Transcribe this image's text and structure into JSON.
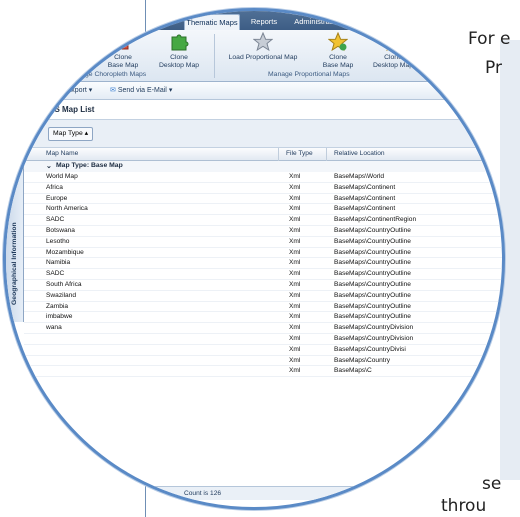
{
  "document": {
    "line1": "For e",
    "line2": "Pr",
    "line3": "se",
    "line4": "throu"
  },
  "ribbon": {
    "tabs": [
      "aps",
      "Thematic Maps",
      "Reports",
      "Administration"
    ],
    "active_tab": "Thematic Maps",
    "buttons": {
      "clone_base_map": "Clone\nBase Map",
      "clone_desktop_map": "Clone\nDesktop Map",
      "load_proportional_map": "Load Proportional Map",
      "clone_base_map_2": "Clone\nBase Map",
      "clone_desktop_map_2": "Clone\nDesktop Map"
    },
    "groups": {
      "choropleth": "Manage Choropleth Maps",
      "proportional": "Manage Proportional Maps"
    }
  },
  "toolbar": {
    "export": "Export",
    "send_email": "Send via E-Mail"
  },
  "list": {
    "title": "GIS Map List",
    "group_button": "Map Type",
    "side_tab": "Geographical Information",
    "columns": {
      "name": "Map Name",
      "type": "File Type",
      "location": "Relative Location"
    },
    "group_label": "Map Type: Base Map",
    "rows": [
      {
        "name": "World Map",
        "type": "Xml",
        "loc": "BaseMaps\\World"
      },
      {
        "name": "Africa",
        "type": "Xml",
        "loc": "BaseMaps\\Continent"
      },
      {
        "name": "Europe",
        "type": "Xml",
        "loc": "BaseMaps\\Continent"
      },
      {
        "name": "North America",
        "type": "Xml",
        "loc": "BaseMaps\\Continent"
      },
      {
        "name": "SADC",
        "type": "Xml",
        "loc": "BaseMaps\\ContinentRegion"
      },
      {
        "name": "Botswana",
        "type": "Xml",
        "loc": "BaseMaps\\CountryOutline"
      },
      {
        "name": "Lesotho",
        "type": "Xml",
        "loc": "BaseMaps\\CountryOutline"
      },
      {
        "name": "Mozambique",
        "type": "Xml",
        "loc": "BaseMaps\\CountryOutline"
      },
      {
        "name": "Namibia",
        "type": "Xml",
        "loc": "BaseMaps\\CountryOutline"
      },
      {
        "name": "SADC",
        "type": "Xml",
        "loc": "BaseMaps\\CountryOutline"
      },
      {
        "name": "South Africa",
        "type": "Xml",
        "loc": "BaseMaps\\CountryOutline"
      },
      {
        "name": "Swaziland",
        "type": "Xml",
        "loc": "BaseMaps\\CountryOutline"
      },
      {
        "name": "Zambia",
        "type": "Xml",
        "loc": "BaseMaps\\CountryOutline"
      },
      {
        "name": "imbabwe",
        "type": "Xml",
        "loc": "BaseMaps\\CountryOutline"
      },
      {
        "name": "wana",
        "type": "Xml",
        "loc": "BaseMaps\\CountryDivision"
      },
      {
        "name": "",
        "type": "Xml",
        "loc": "BaseMaps\\CountryDivision"
      },
      {
        "name": "",
        "type": "Xml",
        "loc": "BaseMaps\\CountryDivisi"
      },
      {
        "name": "",
        "type": "Xml",
        "loc": "BaseMaps\\Country"
      },
      {
        "name": "",
        "type": "Xml",
        "loc": "BaseMaps\\C"
      }
    ],
    "footer": "Count is 126"
  },
  "colors": {
    "accent": "#5a8ac6",
    "ribbon_dark": "#3d5d85"
  }
}
